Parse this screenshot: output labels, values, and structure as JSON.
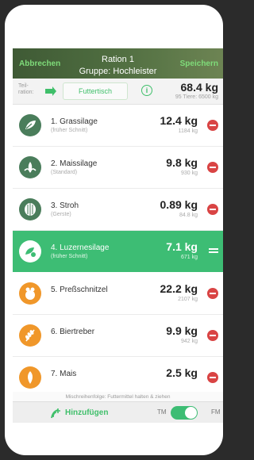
{
  "header": {
    "cancel_label": "Abbrechen",
    "save_label": "Speichern",
    "title": "Ration 1",
    "subtitle": "Gruppe: Hochleister"
  },
  "toolbar": {
    "mix_label": "Teil-\nration:",
    "table_label": "Futtertisch",
    "info_icon": "i",
    "total": "68.4 kg",
    "fresh_info": "95 Tiere: 6500 kg"
  },
  "items": [
    {
      "name": "1. Grassilage",
      "sub": "(früher Schnitt)",
      "qty": "12.4 kg",
      "qty_sub": "1184 kg",
      "icon": "grass-silage-icon",
      "color": "#4a7d5b",
      "selected": false,
      "action": "delete"
    },
    {
      "name": "2. Maissilage",
      "sub": "(Standard)",
      "qty": "9.8 kg",
      "qty_sub": "930 kg",
      "icon": "maize-silage-icon",
      "color": "#4a7d5b",
      "selected": false,
      "action": "delete"
    },
    {
      "name": "3. Stroh",
      "sub": "(Gerste)",
      "qty": "0.89 kg",
      "qty_sub": "84.8 kg",
      "icon": "straw-icon",
      "color": "#4a7d5b",
      "selected": false,
      "action": "delete"
    },
    {
      "name": "4. Luzernesilage",
      "sub": "(früher Schnitt)",
      "qty": "7.1 kg",
      "qty_sub": "671 kg",
      "icon": "alfalfa-silage-icon",
      "color": "#ffffff",
      "selected": true,
      "action": "drag"
    },
    {
      "name": "5. Preßschnitzel",
      "sub": "",
      "qty": "22.2 kg",
      "qty_sub": "2107 kg",
      "icon": "beet-pulp-icon",
      "color": "#f0972a",
      "selected": false,
      "action": "delete"
    },
    {
      "name": "6. Biertreber",
      "sub": "",
      "qty": "9.9 kg",
      "qty_sub": "942 kg",
      "icon": "brewers-grain-icon",
      "color": "#f0972a",
      "selected": false,
      "action": "delete"
    },
    {
      "name": "7. Mais",
      "sub": "",
      "qty": "2.5 kg",
      "qty_sub": "",
      "icon": "corn-icon",
      "color": "#f0972a",
      "selected": false,
      "action": "delete"
    }
  ],
  "hint": "Mischreihenfolge: Futtermittel halten & ziehen",
  "bottom": {
    "add_label": "Hinzufügen",
    "tm_label": "TM",
    "fm_label": "FM",
    "toggle_state": "FM"
  }
}
